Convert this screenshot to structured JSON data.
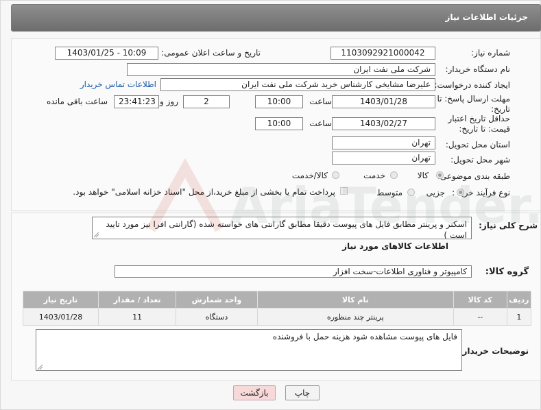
{
  "page": {
    "title": "جزئیات اطلاعات نیاز"
  },
  "labels": {
    "need_number": "شماره نیاز:",
    "announce_datetime": "تاریخ و ساعت اعلان عمومی:",
    "buyer_org": "نام دستگاه خریدار:",
    "requester": "ایجاد کننده درخواست:",
    "reply_deadline": "مهلت ارسال پاسخ: تا تاریخ:",
    "time": "ساعت",
    "day_and": "روز و",
    "hours_left": "ساعت باقی مانده",
    "price_validity": "حداقل تاریخ اعتبار قیمت: تا تاریخ:",
    "delivery_province": "استان محل تحویل:",
    "delivery_city": "شهر محل تحویل:",
    "category": "طبقه بندی موضوعی:",
    "purchase_process": "نوع فرآیند خرید :",
    "description": "شرح کلی نیاز:",
    "goods_info": "اطلاعات کالاهای مورد نیاز",
    "goods_group": "گروه کالا:",
    "buyer_notes": "توضیحات خریدار:"
  },
  "values": {
    "need_number": "1103092921000042",
    "announce_datetime": "1403/01/25 - 10:09",
    "buyer_org": "شرکت ملی نفت ایران",
    "requester": "علیرضا مشایخی کارشناس خرید  شرکت ملی نفت ایران",
    "buyer_contact_link": "اطلاعات تماس خریدار",
    "reply_date": "1403/01/28",
    "reply_time": "10:00",
    "days_left": "2",
    "time_left": "23:41:23",
    "validity_date": "1403/02/27",
    "validity_time": "10:00",
    "province": "تهران",
    "city": "تهران",
    "description": "اسکنر و پرینتر مطابق فایل های پیوست دقیقا مطابق گارانتی های خواسته شده (گارانتی افرا نیز مورد تایید است )",
    "goods_group": "کامپیوتر و فناوری اطلاعات-سخت افزار",
    "buyer_notes": "فایل های پیوست مشاهده شود هزینه حمل با فروشنده"
  },
  "category_options": [
    {
      "label": "کالا",
      "selected": true
    },
    {
      "label": "خدمت",
      "selected": false
    },
    {
      "label": "کالا/خدمت",
      "selected": false
    }
  ],
  "process_options": [
    {
      "label": "جزیی",
      "selected": true
    },
    {
      "label": "متوسط",
      "selected": false
    }
  ],
  "payment_note": "پرداخت تمام یا بخشی از مبلغ خرید،از محل \"اسناد خزانه اسلامی\" خواهد بود.",
  "table": {
    "headers": [
      "ردیف",
      "کد کالا",
      "نام کالا",
      "واحد شمارش",
      "تعداد / مقدار",
      "تاریخ نیاز"
    ],
    "rows": [
      [
        "1",
        "--",
        "پرینتر چند منظوره",
        "دستگاه",
        "11",
        "1403/01/28"
      ]
    ]
  },
  "buttons": {
    "print": "چاپ",
    "back": "بازگشت"
  },
  "watermark_text": "AriaTender.neT",
  "colors": {
    "header": "#7d7d7d",
    "link": "#1a5aa8",
    "table_header": "#b1b1b1",
    "back_button": "#f6d9d9"
  }
}
